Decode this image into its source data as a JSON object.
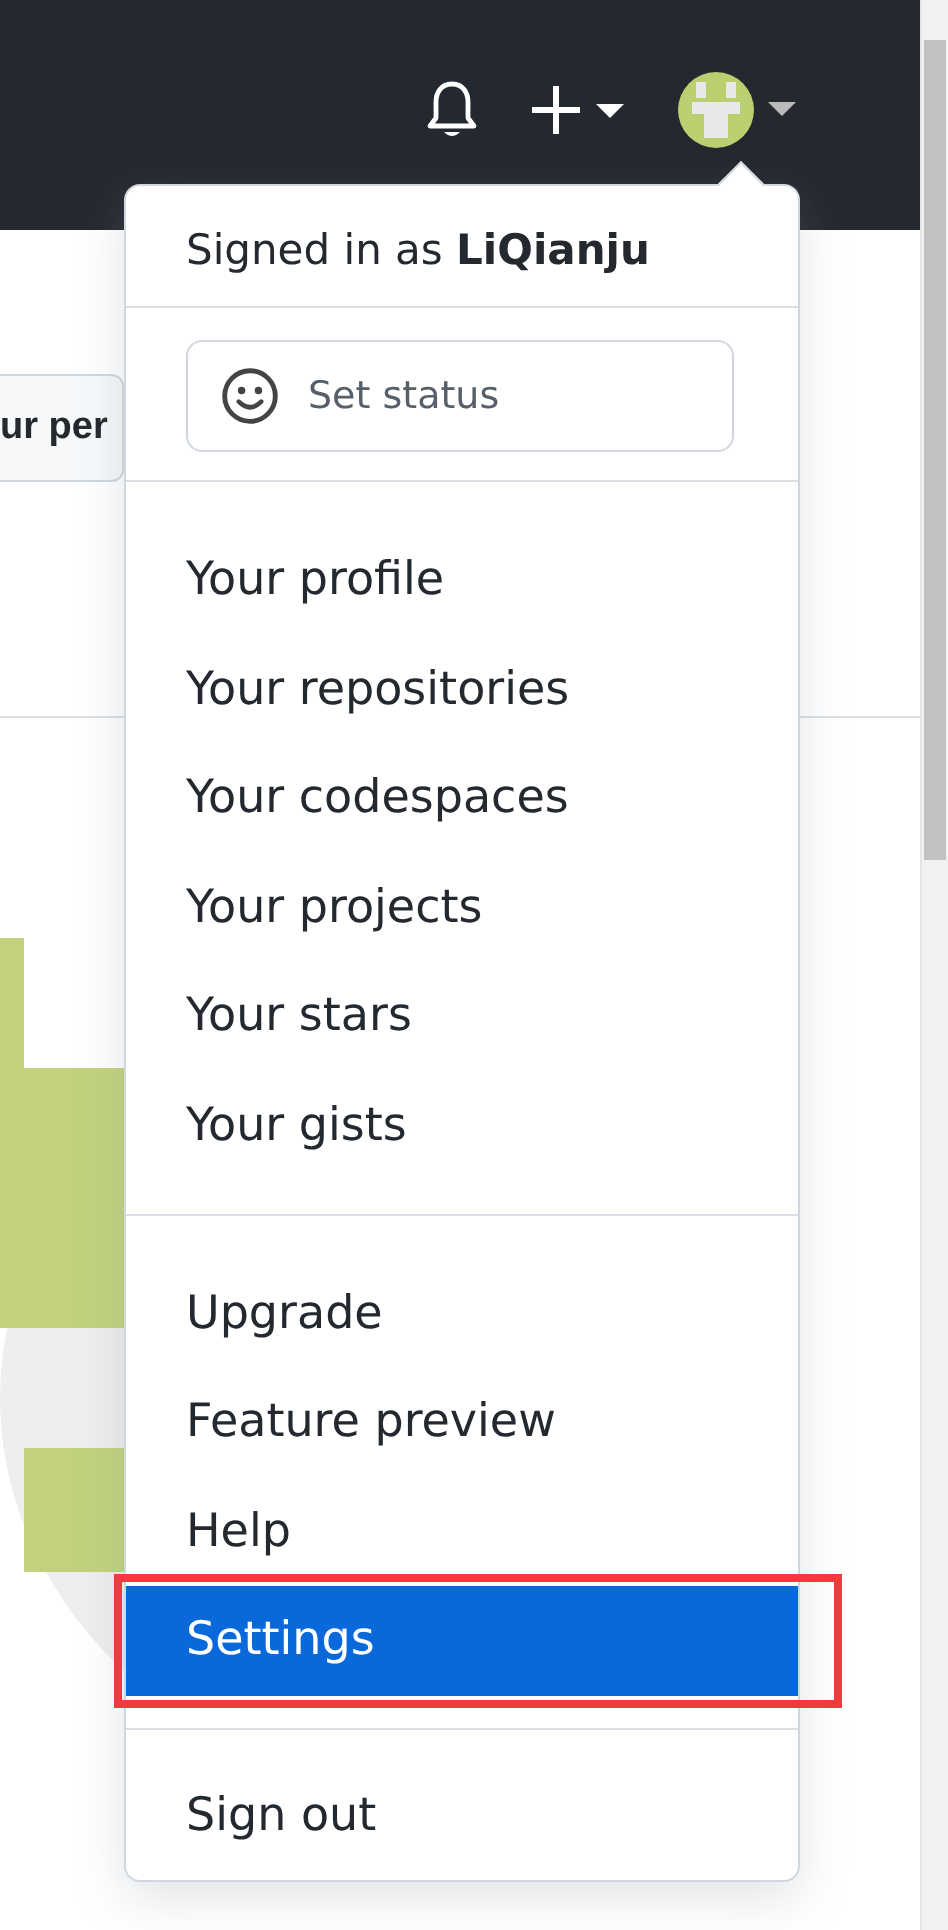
{
  "page": {
    "button": "ur per"
  },
  "menu": {
    "signed_in": "Signed in as **LiQianju**",
    "status_button": "Set status",
    "sections": [
      {
        "items": [
          {
            "label": "Your profile",
            "selected": false
          },
          {
            "label": "Your repositories",
            "selected": false
          },
          {
            "label": "Your codespaces",
            "selected": false
          },
          {
            "label": "Your projects",
            "selected": false
          },
          {
            "label": "Your stars",
            "selected": false
          },
          {
            "label": "Your gists",
            "selected": false
          }
        ]
      },
      {
        "items": [
          {
            "label": "Upgrade",
            "selected": false
          },
          {
            "label": "Feature preview",
            "selected": false
          },
          {
            "label": "Help",
            "selected": false
          },
          {
            "label": "Settings",
            "selected": true
          }
        ]
      },
      {
        "items": [
          {
            "label": "Sign out",
            "selected": false
          }
        ]
      }
    ]
  }
}
